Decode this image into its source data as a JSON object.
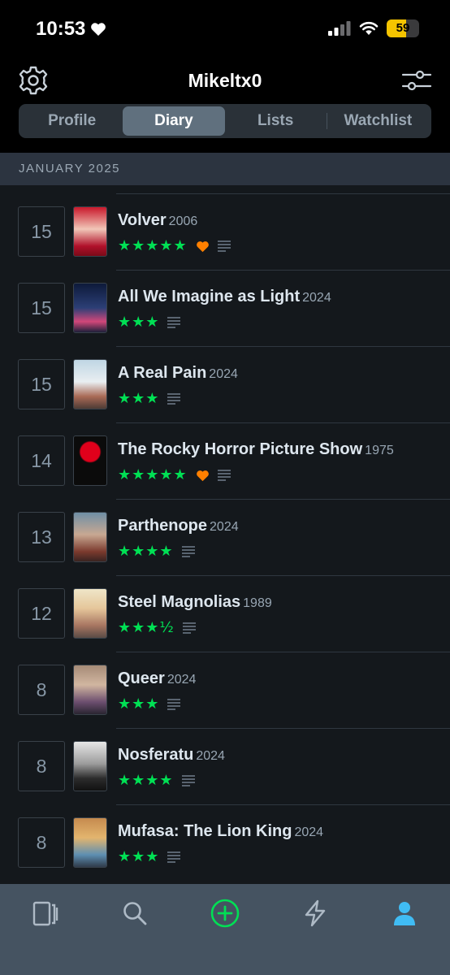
{
  "status_bar": {
    "time": "10:53",
    "battery": "59",
    "battery_level": 0.59
  },
  "header": {
    "title": "Mikeltx0"
  },
  "tabs": [
    {
      "label": "Profile",
      "active": false
    },
    {
      "label": "Diary",
      "active": true
    },
    {
      "label": "Lists",
      "active": false
    },
    {
      "label": "Watchlist",
      "active": false
    }
  ],
  "month": "JANUARY 2025",
  "entries": [
    {
      "day": "15",
      "title": "Volver",
      "year": "2006",
      "rating": "★★★★★",
      "liked": true,
      "review": true
    },
    {
      "day": "15",
      "title": "All We Imagine as Light",
      "year": "2024",
      "rating": "★★★",
      "liked": false,
      "review": true
    },
    {
      "day": "15",
      "title": "A Real Pain",
      "year": "2024",
      "rating": "★★★",
      "liked": false,
      "review": true
    },
    {
      "day": "14",
      "title": "The Rocky Horror Picture Show",
      "year": "1975",
      "rating": "★★★★★",
      "liked": true,
      "review": true
    },
    {
      "day": "13",
      "title": "Parthenope",
      "year": "2024",
      "rating": "★★★★",
      "liked": false,
      "review": true
    },
    {
      "day": "12",
      "title": "Steel Magnolias",
      "year": "1989",
      "rating": "★★★½",
      "liked": false,
      "review": true
    },
    {
      "day": "8",
      "title": "Queer",
      "year": "2024",
      "rating": "★★★",
      "liked": false,
      "review": true
    },
    {
      "day": "8",
      "title": "Nosferatu",
      "year": "2024",
      "rating": "★★★★",
      "liked": false,
      "review": true
    },
    {
      "day": "8",
      "title": "Mufasa: The Lion King",
      "year": "2024",
      "rating": "★★★",
      "liked": false,
      "review": true
    }
  ],
  "bottom_nav": [
    {
      "icon": "films-icon",
      "active": false
    },
    {
      "icon": "search-icon",
      "active": false
    },
    {
      "icon": "add-icon",
      "active": false
    },
    {
      "icon": "activity-icon",
      "active": false
    },
    {
      "icon": "profile-icon",
      "active": true
    }
  ],
  "colors": {
    "accent_green": "#00e054",
    "like_orange": "#ff8000",
    "active_blue": "#40bcf4",
    "background": "#14181c"
  }
}
